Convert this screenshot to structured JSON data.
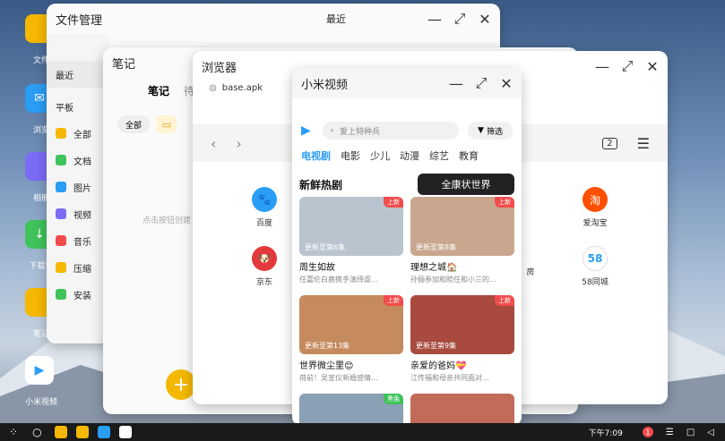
{
  "desktop": {
    "icons": [
      {
        "label": "文件",
        "color": "#f5b800"
      },
      {
        "label": "浏览",
        "color": "#2a9df4"
      },
      {
        "label": "相册",
        "color": "#7b6cf6"
      },
      {
        "label": "下载管",
        "color": "#3fc35a"
      },
      {
        "label": "笔记",
        "color": "#f5b800"
      },
      {
        "label": "小米视频",
        "color": "#ffffff"
      }
    ]
  },
  "file_manager": {
    "title": "文件管理",
    "header_right": "最近",
    "sidebar": {
      "recent": "最近",
      "tablet": "平板",
      "items": [
        {
          "label": "全部",
          "color": "#f5b800"
        },
        {
          "label": "文档",
          "color": "#3fc35a"
        },
        {
          "label": "图片",
          "color": "#2a9df4"
        },
        {
          "label": "视频",
          "color": "#7b6cf6"
        },
        {
          "label": "音乐",
          "color": "#f14c4c"
        },
        {
          "label": "压缩",
          "color": "#f5b800"
        },
        {
          "label": "安装",
          "color": "#3fc35a"
        }
      ]
    }
  },
  "notes": {
    "title": "笔记",
    "tabs": [
      "笔记",
      "待"
    ],
    "filter_all": "全部",
    "hint": "点击按钮创建",
    "fab_icon": "plus-icon"
  },
  "browser": {
    "title": "浏览器",
    "tab_title": "base.apk",
    "tab_count": "2",
    "shortcuts": [
      {
        "label": "百度",
        "color": "#2a9df4",
        "glyph": "🐾"
      },
      {
        "label": "京东",
        "color": "#e4393c",
        "glyph": "🐶"
      },
      {
        "label": "爱淘宝",
        "color": "#ff5000",
        "glyph": "淘"
      },
      {
        "label": "58同城",
        "color": "#ffffff",
        "glyph": "58"
      },
      {
        "label": "房",
        "color": "#2a9df4",
        "glyph": ""
      }
    ]
  },
  "video": {
    "title": "小米视频",
    "search_placeholder": "爱上特种兵",
    "filter_label": "筛选",
    "categories": [
      "电视剧",
      "电影",
      "少儿",
      "动漫",
      "综艺",
      "教育"
    ],
    "section_title": "新鲜热剧",
    "banner_text": "全康状世界",
    "cards": [
      {
        "title": "周生如故",
        "desc": "任嘉伦白鹿携手演绎虐...",
        "update": "更新至第6集",
        "tag": "上新",
        "tag_color": "#f14c4c",
        "thumb": "#b9c4cf"
      },
      {
        "title": "理想之城🏠",
        "desc": "孙俪参加和睦任和小三的...",
        "update": "更新至第8集",
        "tag": "上新",
        "tag_color": "#f14c4c",
        "thumb": "#c9a78e"
      },
      {
        "title": "世界微尘里😊",
        "desc": "荷前！吴宣仪新婚感情...",
        "update": "更新至第13集",
        "tag": "上新",
        "tag_color": "#f14c4c",
        "thumb": "#c58a5e"
      },
      {
        "title": "亲爱的爸妈💝",
        "desc": "江传福和母亲共同面对...",
        "update": "更新至第9集",
        "tag": "上新",
        "tag_color": "#f14c4c",
        "thumb": "#a84a3e"
      },
      {
        "title": "",
        "desc": "",
        "update": "",
        "tag": "黑兔",
        "tag_color": "#3fc35a",
        "thumb": "#8aa0b4"
      },
      {
        "title": "",
        "desc": "",
        "update": "",
        "tag": "",
        "tag_color": "#f14c4c",
        "thumb": "#c36b5a"
      }
    ]
  },
  "taskbar": {
    "time": "下午7:09",
    "notif_count": "1"
  }
}
